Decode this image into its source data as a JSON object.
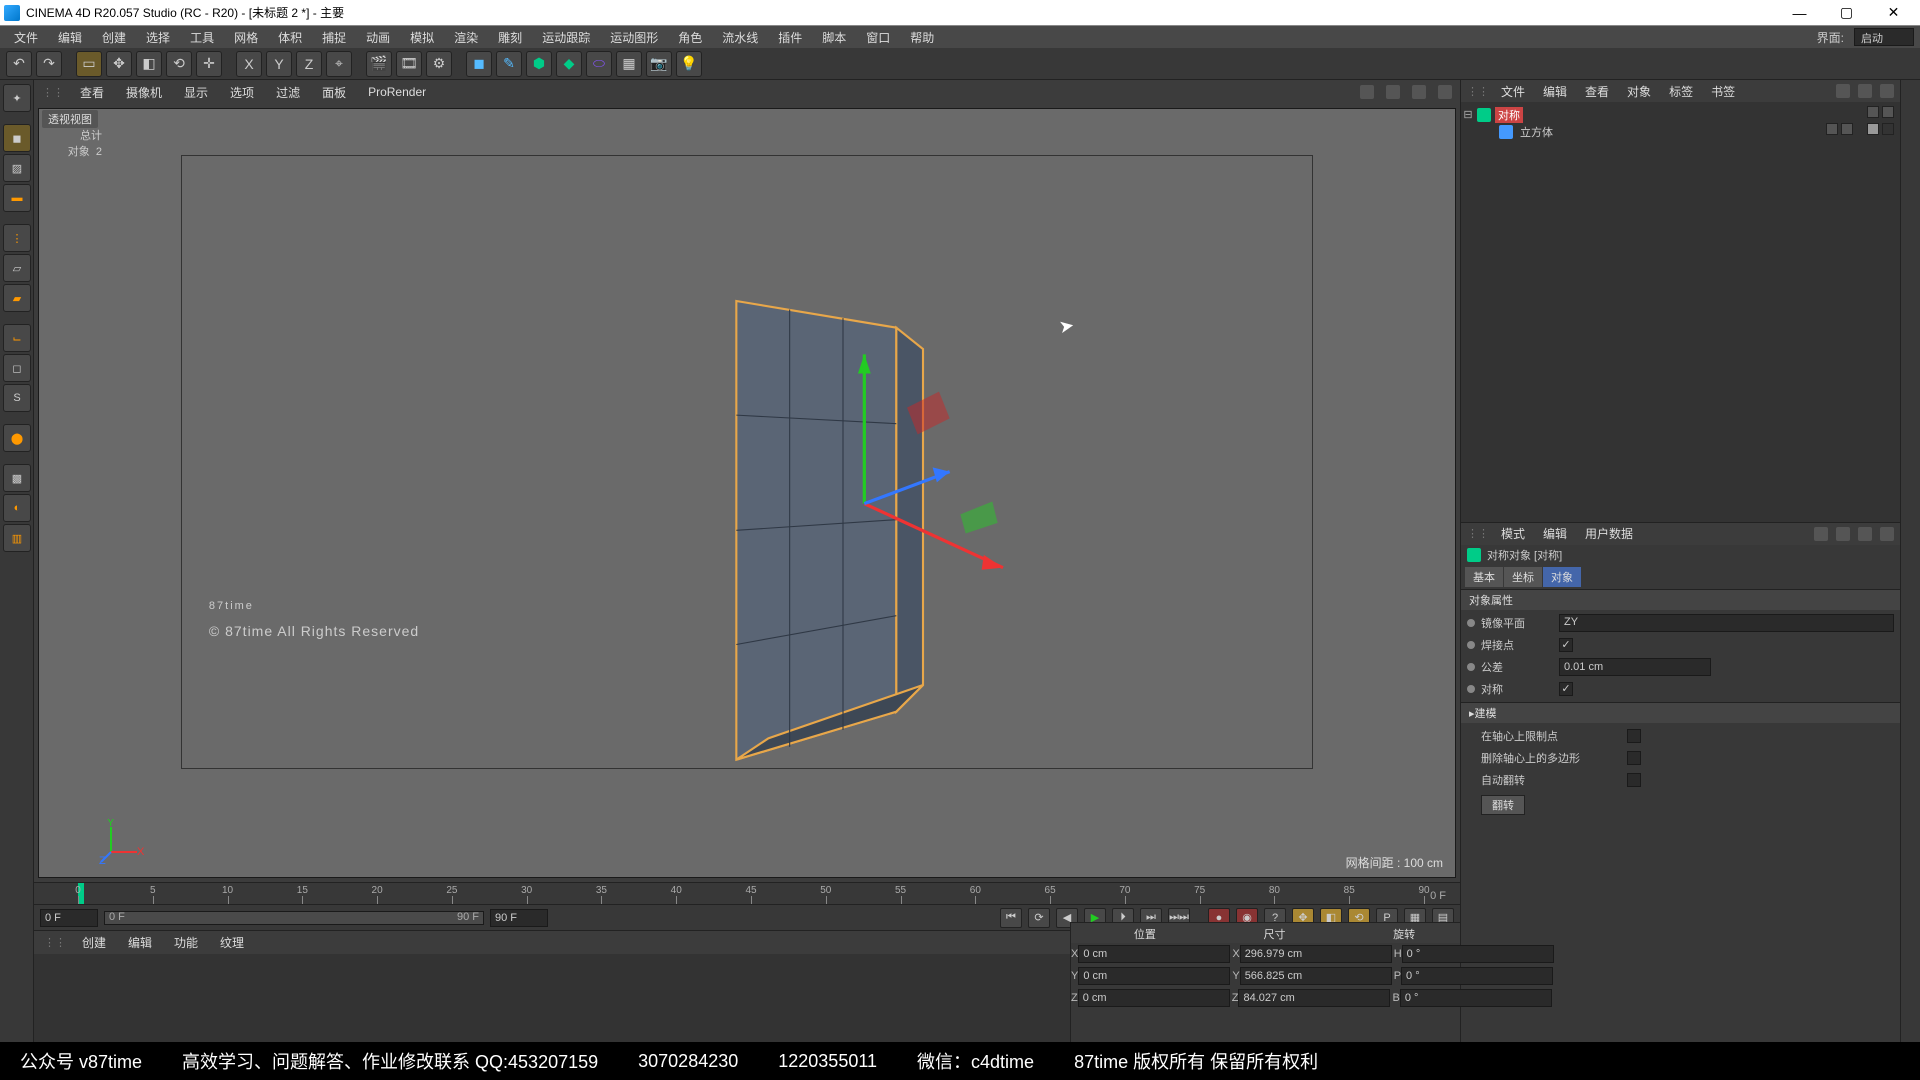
{
  "title": "CINEMA 4D R20.057 Studio (RC - R20) - [未标题 2 *] - 主要",
  "menus": [
    "文件",
    "编辑",
    "创建",
    "选择",
    "工具",
    "网格",
    "体积",
    "捕捉",
    "动画",
    "模拟",
    "渲染",
    "雕刻",
    "运动跟踪",
    "运动图形",
    "角色",
    "流水线",
    "插件",
    "脚本",
    "窗口",
    "帮助"
  ],
  "layout_label": "界面:",
  "layout_value": "启动",
  "view_menus": [
    "查看",
    "摄像机",
    "显示",
    "选项",
    "过滤",
    "面板",
    "ProRender"
  ],
  "viewport_label": "透视视图",
  "stats_total_label": "总计",
  "stats_objects_label": "对象",
  "stats_objects_value": "2",
  "grid_info": "网格间距 : 100 cm",
  "watermark": "87time",
  "watermark_sub": "© 87time All Rights Reserved",
  "timeline": {
    "start": "0 F",
    "range_start": "0 F",
    "range_end": "90 F",
    "end": "90 F",
    "end_marker": "0 F",
    "ticks": [
      0,
      5,
      10,
      15,
      20,
      25,
      30,
      35,
      40,
      45,
      50,
      55,
      60,
      65,
      70,
      75,
      80,
      85,
      90
    ]
  },
  "lower_tabs": [
    "创建",
    "编辑",
    "功能",
    "纹理"
  ],
  "coord": {
    "headers": [
      "位置",
      "尺寸",
      "旋转"
    ],
    "rows": [
      {
        "a": "X",
        "p": "0 cm",
        "sl": "X",
        "s": "296.979 cm",
        "rl": "H",
        "r": "0 °"
      },
      {
        "a": "Y",
        "p": "0 cm",
        "sl": "Y",
        "s": "566.825 cm",
        "rl": "P",
        "r": "0 °"
      },
      {
        "a": "Z",
        "p": "0 cm",
        "sl": "Z",
        "s": "84.027 cm",
        "rl": "B",
        "r": "0 °"
      }
    ]
  },
  "om_menus": [
    "文件",
    "编辑",
    "查看",
    "对象",
    "标签",
    "书签"
  ],
  "tree": {
    "parent": "对称",
    "child": "立方体"
  },
  "am_menus": [
    "模式",
    "编辑",
    "用户数据"
  ],
  "am_title": "对称对象 [对称]",
  "am_tabs": [
    "基本",
    "坐标",
    "对象"
  ],
  "am_section": "对象属性",
  "props": {
    "mirror_label": "镜像平面",
    "mirror_value": "ZY",
    "weld_label": "焊接点",
    "tol_label": "公差",
    "tol_value": "0.01 cm",
    "sym_label": "对称",
    "model_section": "▸建模",
    "limit_label": "在轴心上限制点",
    "delete_label": "删除轴心上的多边形",
    "autoflip_label": "自动翻转",
    "flip_btn": "翻转"
  },
  "footer": {
    "a": "公众号 v87time",
    "b": "高效学习、问题解答、作业修改联系 QQ:453207159",
    "c": "3070284230",
    "d": "1220355011",
    "e": "微信：c4dtime",
    "f": "87time 版权所有  保留所有权利"
  }
}
